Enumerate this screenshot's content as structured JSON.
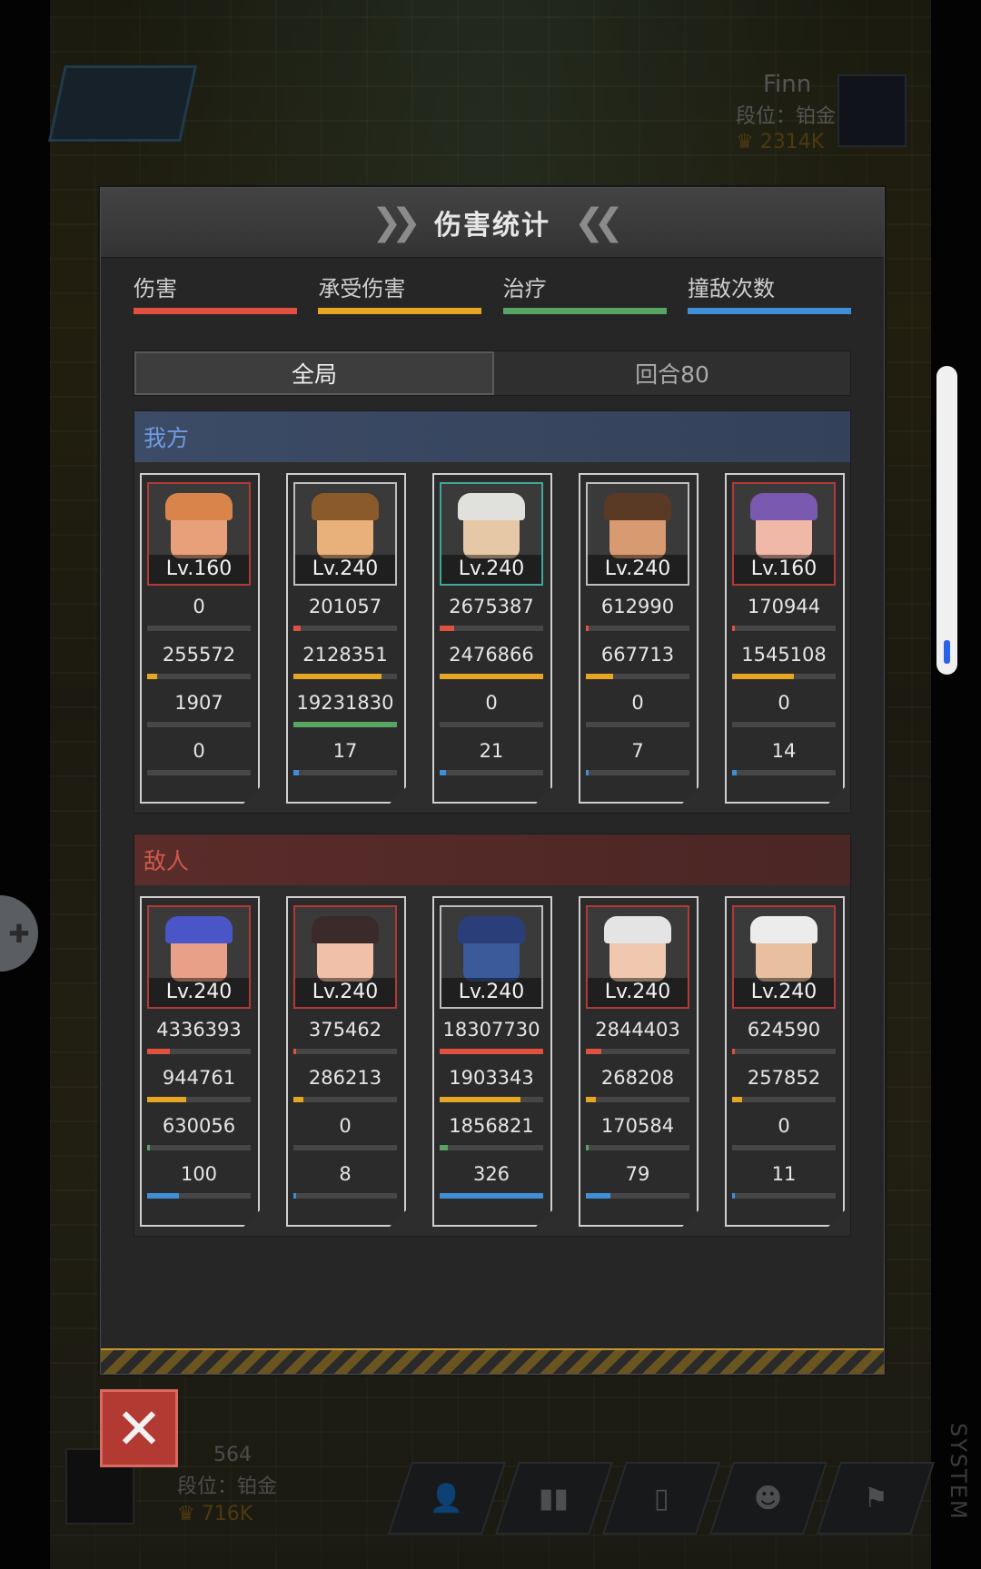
{
  "background": {
    "opponent": {
      "name": "Finn",
      "rank": "段位：铂金",
      "power": "2314K"
    },
    "player": {
      "name": "564",
      "rank": "段位：铂金",
      "power": "716K"
    },
    "bottom_icons": [
      "user-list-icon",
      "bar-chart-icon",
      "bottle-icon",
      "emoji-icon",
      "flag-icon"
    ]
  },
  "panel": {
    "title": "伤害统计",
    "categories": [
      {
        "label": "伤害",
        "color": "#e0513f"
      },
      {
        "label": "承受伤害",
        "color": "#e6a522"
      },
      {
        "label": "治疗",
        "color": "#58a463"
      },
      {
        "label": "撞敌次数",
        "color": "#3f8fd6"
      }
    ],
    "scope_tabs": [
      {
        "label": "全局",
        "active": true
      },
      {
        "label": "回合80",
        "active": false
      }
    ],
    "close_icon": "close-x-icon",
    "watermark": "SYSTEM"
  },
  "allies": {
    "title": "我方",
    "units": [
      {
        "level": "Lv.160",
        "skin": "#e8a07a",
        "hair": "#d8844a",
        "frame": "red",
        "stats": [
          "0",
          "255572",
          "1907",
          "0"
        ],
        "fills": [
          0,
          0.1,
          0,
          0
        ]
      },
      {
        "level": "Lv.240",
        "skin": "#e8b07a",
        "hair": "#8a5a2a",
        "frame": "ally-hl",
        "stats": [
          "201057",
          "2128351",
          "19231830",
          "17"
        ],
        "fills": [
          0.07,
          0.85,
          1.0,
          0.05
        ]
      },
      {
        "level": "Lv.240",
        "skin": "#e6c8a6",
        "hair": "#e0e0dc",
        "frame": "teal",
        "stats": [
          "2675387",
          "2476866",
          "0",
          "21"
        ],
        "fills": [
          0.14,
          1.0,
          0,
          0.06
        ]
      },
      {
        "level": "Lv.240",
        "skin": "#d89a70",
        "hair": "#5a3a24",
        "frame": "ally-hl",
        "stats": [
          "612990",
          "667713",
          "0",
          "7"
        ],
        "fills": [
          0.03,
          0.26,
          0,
          0.02
        ]
      },
      {
        "level": "Lv.160",
        "skin": "#f0b8a6",
        "hair": "#7a5ab0",
        "frame": "red",
        "stats": [
          "170944",
          "1545108",
          "0",
          "14"
        ],
        "fills": [
          0.01,
          0.6,
          0,
          0.04
        ]
      }
    ]
  },
  "enemies": {
    "title": "敌人",
    "units": [
      {
        "level": "Lv.240",
        "skin": "#e8a088",
        "hair": "#4a56c8",
        "frame": "red",
        "stats": [
          "4336393",
          "944761",
          "630056",
          "100"
        ],
        "fills": [
          0.22,
          0.38,
          0.03,
          0.31
        ]
      },
      {
        "level": "Lv.240",
        "skin": "#f0c0a8",
        "hair": "#3a2a2a",
        "frame": "red",
        "stats": [
          "375462",
          "286213",
          "0",
          "8"
        ],
        "fills": [
          0.01,
          0.1,
          0,
          0.02
        ]
      },
      {
        "level": "Lv.240",
        "skin": "#3a5a9a",
        "hair": "#2a3e7a",
        "frame": "ally-hl",
        "stats": [
          "18307730",
          "1903343",
          "1856821",
          "326"
        ],
        "fills": [
          1.0,
          0.78,
          0.08,
          1.0
        ]
      },
      {
        "level": "Lv.240",
        "skin": "#f0c8b0",
        "hair": "#e4e4e4",
        "frame": "red",
        "stats": [
          "2844403",
          "268208",
          "170584",
          "79"
        ],
        "fills": [
          0.15,
          0.1,
          0.01,
          0.24
        ]
      },
      {
        "level": "Lv.240",
        "skin": "#e8c0a0",
        "hair": "#ececec",
        "frame": "red",
        "stats": [
          "624590",
          "257852",
          "0",
          "11"
        ],
        "fills": [
          0.03,
          0.1,
          0,
          0.03
        ]
      }
    ]
  }
}
